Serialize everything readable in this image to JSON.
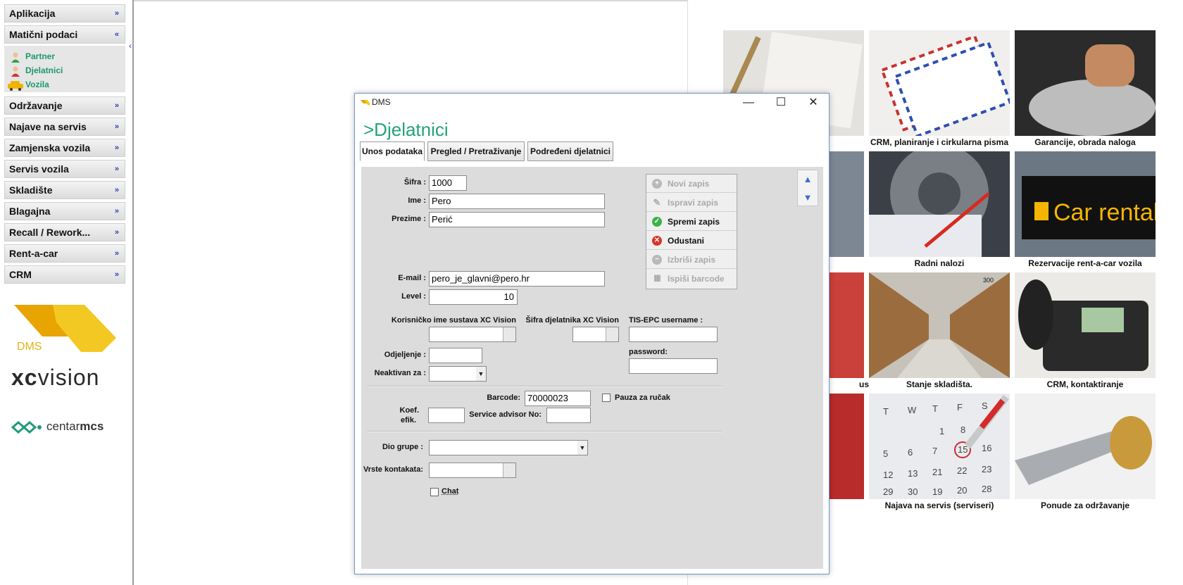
{
  "sidebar": {
    "menu": [
      {
        "label": "Aplikacija",
        "chevron": "»"
      },
      {
        "label": "Matični podaci",
        "chevron": "«"
      },
      {
        "label": "Održavanje",
        "chevron": "»"
      },
      {
        "label": "Najave na servis",
        "chevron": "»"
      },
      {
        "label": "Zamjenska vozila",
        "chevron": "»"
      },
      {
        "label": "Servis vozila",
        "chevron": "»"
      },
      {
        "label": "Skladište",
        "chevron": "»"
      },
      {
        "label": "Blagajna",
        "chevron": "»"
      },
      {
        "label": "Recall / Rework...",
        "chevron": "»"
      },
      {
        "label": "Rent-a-car",
        "chevron": "»"
      },
      {
        "label": "CRM",
        "chevron": "»"
      }
    ],
    "submenu": [
      {
        "label": "Partner",
        "icon": "person-icon"
      },
      {
        "label": "Djelatnici",
        "icon": "employee-icon"
      },
      {
        "label": "Vozila",
        "icon": "car-icon"
      }
    ],
    "collapse_arrow": "‹"
  },
  "logos": {
    "dms_text": "DMS",
    "xc_bold": "xc",
    "xc_light": "vision",
    "centar_light": "centar",
    "centar_bold": "mcs"
  },
  "tiles": [
    {
      "caption": "CRM, planiranje i cirkularna pisma"
    },
    {
      "caption": "Garancije, obrada naloga"
    },
    {
      "caption": "Radni nalozi"
    },
    {
      "caption": "Rezervacije rent-a-car vozila"
    },
    {
      "caption": "us"
    },
    {
      "caption": "Stanje skladišta."
    },
    {
      "caption": "CRM, kontaktiranje"
    },
    {
      "caption": "Najava na servis (serviseri)"
    },
    {
      "caption": "Ponude za održavanje"
    }
  ],
  "tile_texts": {
    "car_rental": "Car rental",
    "shelf_300": "300",
    "cal_days": [
      "T",
      "W",
      "T",
      "F",
      "S",
      "1",
      "8",
      "5",
      "6",
      "7",
      "15",
      "16",
      "12",
      "13",
      "21",
      "22",
      "23",
      "19",
      "20",
      "28",
      "29",
      "30"
    ]
  },
  "dialog": {
    "title": "DMS",
    "minimize": "—",
    "maximize": "☐",
    "close": "✕",
    "page_title": ">Djelatnici",
    "tabs": [
      "Unos podataka",
      "Pregled / Pretraživanje",
      "Podređeni djelatnici"
    ],
    "fields": {
      "sifra_label": "Šifra :",
      "sifra_value": "1000",
      "ime_label": "Ime :",
      "ime_value": "Pero",
      "prezime_label": "Prezime :",
      "prezime_value": "Perić",
      "email_label": "E-mail :",
      "email_value": "pero_je_glavni@pero.hr",
      "level_label": "Level :",
      "level_value": "10",
      "kor_ime_label": "Korisničko ime sustava XC Vision :",
      "sifra_djel_label": "Šifra djelatnika XC Vision :",
      "tis_label": "TIS-EPC username :",
      "password_label": "password:",
      "odjeljenje_label": "Odjeljenje :",
      "neaktivan_label": "Neaktivan za :",
      "barcode_label": "Barcode:",
      "barcode_value": "70000023",
      "pauza_label": "Pauza za ručak",
      "koef_label1": "Koef.",
      "koef_label2": "efik.",
      "service_label": "Service advisor No:",
      "dio_grupe_label": "Dio grupe :",
      "vrste_label": "Vrste kontakata:",
      "chat_label": "Chat"
    },
    "actions": [
      {
        "label": "Novi zapis",
        "state": "disabled",
        "icon": "plus-icon"
      },
      {
        "label": "Ispravi zapis",
        "state": "disabled",
        "icon": "pencil-icon"
      },
      {
        "label": "Spremi zapis",
        "state": "enabled",
        "icon": "check-icon"
      },
      {
        "label": "Odustani",
        "state": "enabled",
        "icon": "cancel-icon"
      },
      {
        "label": "Izbriši zapis",
        "state": "disabled",
        "icon": "minus-icon"
      },
      {
        "label": "Ispiši barcode",
        "state": "disabled",
        "icon": "barcode-icon"
      }
    ],
    "scroll_up": "▲",
    "scroll_down": "▼",
    "dropdown_arrow": "▼"
  },
  "colors": {
    "accent_green": "#23a27a",
    "menu_chevron": "#2b3fae",
    "dms_yellow": "#f1c21b"
  }
}
